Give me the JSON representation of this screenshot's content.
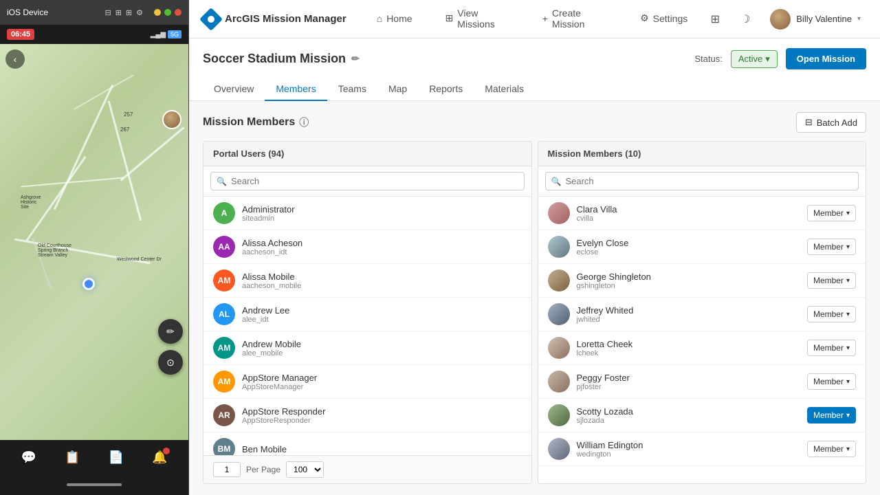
{
  "ios": {
    "title": "iOS Device",
    "time": "06:45",
    "signal": "5G",
    "map_numbers": [
      "257",
      "267"
    ]
  },
  "app": {
    "title": "ArcGIS Mission Manager",
    "nav": {
      "home": "Home",
      "view_missions": "View Missions",
      "create_mission": "Create Mission",
      "settings": "Settings"
    },
    "user": {
      "name": "Billy Valentine",
      "chevron": "▾"
    }
  },
  "mission": {
    "title": "Soccer Stadium Mission",
    "status_label": "Status:",
    "status_value": "Active",
    "open_btn": "Open Mission",
    "tabs": [
      "Overview",
      "Members",
      "Teams",
      "Map",
      "Reports",
      "Materials"
    ],
    "active_tab": "Members"
  },
  "members": {
    "title": "Mission Members",
    "batch_add": "Batch Add",
    "portal": {
      "header": "Portal Users (94)",
      "search_placeholder": "Search",
      "users": [
        {
          "initials": "A",
          "color": "#4CAF50",
          "name": "Administrator",
          "username": "siteadmin"
        },
        {
          "initials": "AA",
          "color": "#9C27B0",
          "name": "Alissa Acheson",
          "username": "aacheson_idt"
        },
        {
          "initials": "AM",
          "color": "#FF5722",
          "name": "Alissa Mobile",
          "username": "aacheson_mobile"
        },
        {
          "initials": "AL",
          "color": "#2196F3",
          "name": "Andrew Lee",
          "username": "alee_idt"
        },
        {
          "initials": "AM",
          "color": "#009688",
          "name": "Andrew Mobile",
          "username": "alee_mobile"
        },
        {
          "initials": "AM",
          "color": "#FF9800",
          "name": "AppStore Manager",
          "username": "AppStoreManager"
        },
        {
          "initials": "AR",
          "color": "#795548",
          "name": "AppStore Responder",
          "username": "AppStoreResponder"
        },
        {
          "initials": "BM",
          "color": "#607D8B",
          "name": "Ben Mobile",
          "username": ""
        }
      ],
      "page": "1",
      "per_page": "100"
    },
    "mission_members": {
      "header": "Mission Members (10)",
      "search_placeholder": "Search",
      "members": [
        {
          "name": "Clara Villa",
          "username": "cvilla",
          "role": "Member",
          "active": false
        },
        {
          "name": "Evelyn Close",
          "username": "eclose",
          "role": "Member",
          "active": false
        },
        {
          "name": "George Shingleton",
          "username": "gshingleton",
          "role": "Member",
          "active": false
        },
        {
          "name": "Jeffrey Whited",
          "username": "jwhited",
          "role": "Member",
          "active": false
        },
        {
          "name": "Loretta Cheek",
          "username": "lcheek",
          "role": "Member",
          "active": false
        },
        {
          "name": "Peggy Foster",
          "username": "pjfoster",
          "role": "Member",
          "active": false
        },
        {
          "name": "Scotty Lozada",
          "username": "sjlozada",
          "role": "Member",
          "active": true
        },
        {
          "name": "William Edington",
          "username": "wedington",
          "role": "Member",
          "active": false
        }
      ]
    }
  },
  "icons": {
    "logo": "◆",
    "home": "⌂",
    "map_marker": "📍",
    "plus": "+",
    "gear": "⚙",
    "search": "🔍",
    "filter": "⊟",
    "edit": "✏",
    "info": "ⓘ",
    "chevron_down": "▾",
    "chevron_right": "›",
    "back": "‹",
    "qr": "⊞",
    "moon": "☽",
    "chat": "💬",
    "clipboard": "📋",
    "doc": "📄",
    "bell": "🔔"
  }
}
